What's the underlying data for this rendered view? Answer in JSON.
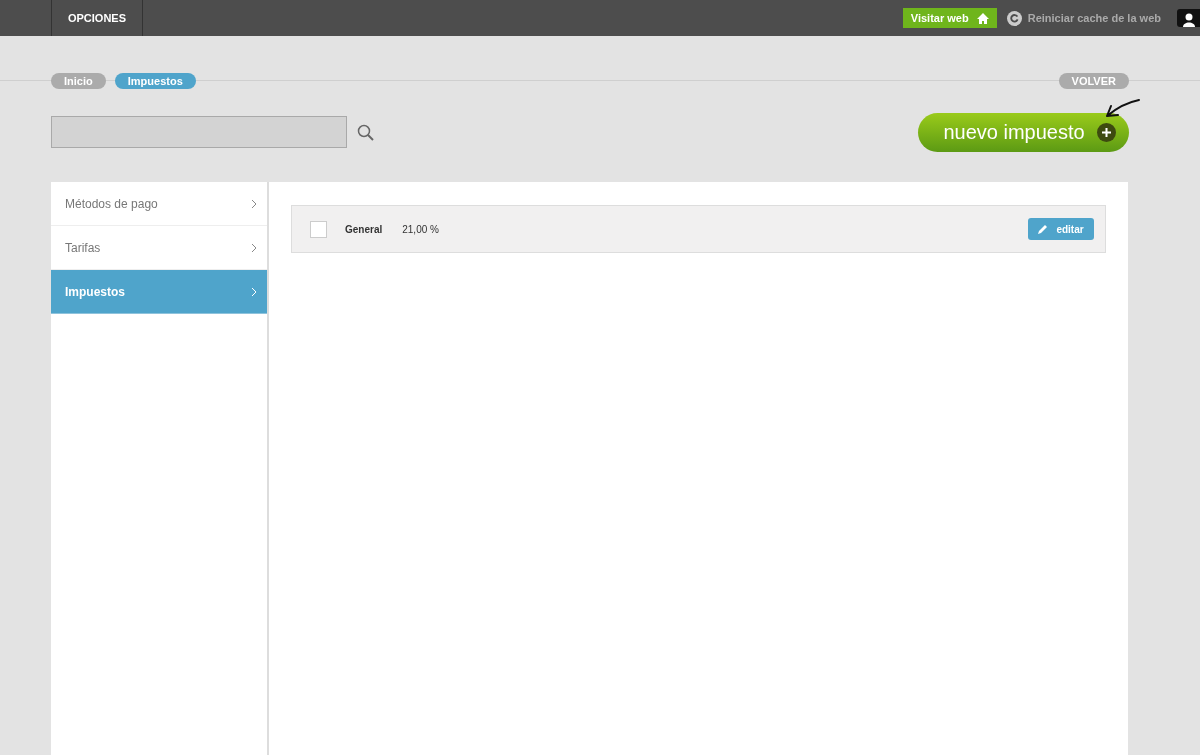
{
  "topbar": {
    "tabs": [
      {
        "label": "OPCIONES"
      }
    ],
    "visit_button": "Visitar web",
    "reset_cache": "Reiniciar cache de la web"
  },
  "breadcrumbs": [
    {
      "label": "Inicio",
      "selected": false
    },
    {
      "label": "Impuestos",
      "selected": true
    }
  ],
  "back_button": "VOLVER",
  "new_button": "nuevo impuesto",
  "sidebar": {
    "items": [
      {
        "label": "Métodos de pago",
        "selected": false
      },
      {
        "label": "Tarifas",
        "selected": false
      },
      {
        "label": "Impuestos",
        "selected": true
      }
    ]
  },
  "rows": [
    {
      "checked": false,
      "name": "General",
      "rate": "21,00 %",
      "edit": "editar"
    }
  ]
}
